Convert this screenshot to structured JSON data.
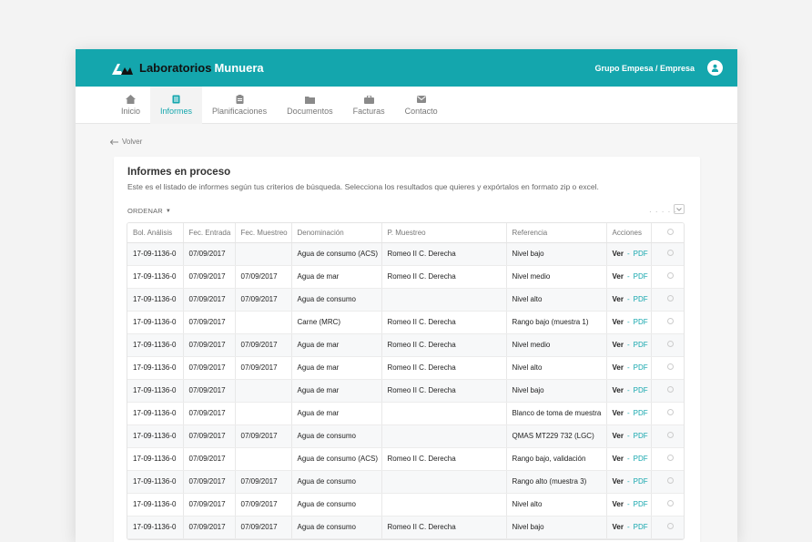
{
  "brand": {
    "name_part1": "Laboratorios",
    "name_part2": "Munuera"
  },
  "header": {
    "company": "Grupo Empesa / Empresa"
  },
  "nav": [
    {
      "label": "Inicio",
      "icon": "home-icon"
    },
    {
      "label": "Informes",
      "icon": "document-icon"
    },
    {
      "label": "Planificaciones",
      "icon": "clipboard-icon"
    },
    {
      "label": "Documentos",
      "icon": "folder-icon"
    },
    {
      "label": "Facturas",
      "icon": "briefcase-icon"
    },
    {
      "label": "Contacto",
      "icon": "mail-icon"
    }
  ],
  "back_label": "Volver",
  "card": {
    "title": "Informes en proceso",
    "description": "Este es el listado de informes según tus criterios de búsqueda. Selecciona los resultados que quieres y expórtalos en formato zip o excel.",
    "sort_label": "ORDENAR",
    "dots": "· · · · ·"
  },
  "table": {
    "headers": [
      "Bol. Análisis",
      "Fec. Entrada",
      "Fec. Muestreo",
      "Denominación",
      "P. Muestreo",
      "Referencia",
      "Acciones",
      ""
    ],
    "action_ver": "Ver",
    "action_sep": "-",
    "action_pdf": "PDF",
    "rows": [
      [
        "17-09-1136-0",
        "07/09/2017",
        "",
        "Agua de consumo (ACS)",
        "Romeo II C. Derecha",
        "Nivel bajo"
      ],
      [
        "17-09-1136-0",
        "07/09/2017",
        "07/09/2017",
        "Agua de mar",
        "Romeo II C. Derecha",
        "Nivel medio"
      ],
      [
        "17-09-1136-0",
        "07/09/2017",
        "07/09/2017",
        "Agua de consumo",
        "",
        "Nivel alto"
      ],
      [
        "17-09-1136-0",
        "07/09/2017",
        "",
        "Carne (MRC)",
        "Romeo II C. Derecha",
        "Rango bajo (muestra 1)"
      ],
      [
        "17-09-1136-0",
        "07/09/2017",
        "07/09/2017",
        "Agua de mar",
        "Romeo II C. Derecha",
        "Nivel medio"
      ],
      [
        "17-09-1136-0",
        "07/09/2017",
        "07/09/2017",
        "Agua de mar",
        "Romeo II C. Derecha",
        "Nivel alto"
      ],
      [
        "17-09-1136-0",
        "07/09/2017",
        "",
        "Agua de mar",
        "Romeo II C. Derecha",
        "Nivel bajo"
      ],
      [
        "17-09-1136-0",
        "07/09/2017",
        "",
        "Agua de mar",
        "",
        "Blanco de toma de muestra"
      ],
      [
        "17-09-1136-0",
        "07/09/2017",
        "07/09/2017",
        "Agua de consumo",
        "",
        "QMAS MT229 732 (LGC)"
      ],
      [
        "17-09-1136-0",
        "07/09/2017",
        "",
        "Agua de consumo (ACS)",
        "Romeo II C. Derecha",
        "Rango bajo, validación"
      ],
      [
        "17-09-1136-0",
        "07/09/2017",
        "07/09/2017",
        "Agua de consumo",
        "",
        "Rango alto (muestra 3)"
      ],
      [
        "17-09-1136-0",
        "07/09/2017",
        "07/09/2017",
        "Agua de consumo",
        "",
        "Nivel alto"
      ],
      [
        "17-09-1136-0",
        "07/09/2017",
        "07/09/2017",
        "Agua de consumo",
        "Romeo II C. Derecha",
        "Nivel bajo"
      ]
    ]
  },
  "colors": {
    "accent": "#14a6ad",
    "background": "#f3f3f3"
  }
}
